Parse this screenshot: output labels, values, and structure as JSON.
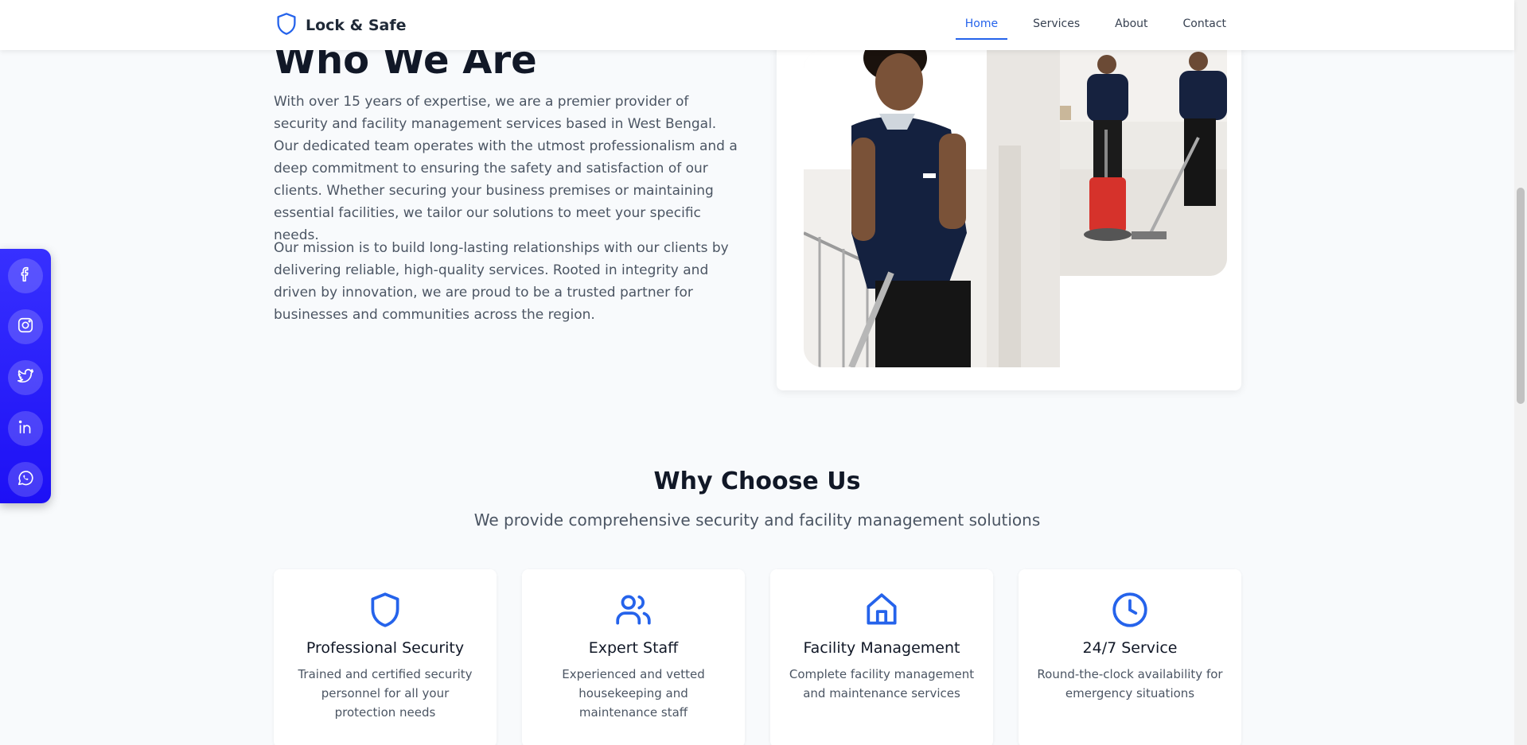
{
  "header": {
    "brand": "Lock & Safe",
    "nav": [
      "Home",
      "Services",
      "About",
      "Contact"
    ],
    "active_nav": "Home"
  },
  "about": {
    "title": "Who We Are",
    "paragraph1": "With over 15 years of expertise, we are a premier provider of security and facility management services based in West Bengal. Our dedicated team operates with the utmost professionalism and a deep commitment to ensuring the safety and satisfaction of our clients. Whether securing your business premises or maintaining essential facilities, we tailor our solutions to meet your specific needs.",
    "paragraph2": "Our mission is to build long-lasting relationships with our clients by delivering reliable, high-quality services. Rooted in integrity and driven by innovation, we are proud to be a trusted partner for businesses and communities across the region."
  },
  "social": [
    "facebook-icon",
    "instagram-icon",
    "twitter-icon",
    "linkedin-icon",
    "whatsapp-icon"
  ],
  "why": {
    "title": "Why Choose Us",
    "subtitle": "We provide comprehensive security and facility management solutions",
    "features": [
      {
        "icon": "shield-icon",
        "title": "Professional Security",
        "desc": "Trained and certified security personnel for all your protection needs"
      },
      {
        "icon": "users-icon",
        "title": "Expert Staff",
        "desc": "Experienced and vetted housekeeping and maintenance staff"
      },
      {
        "icon": "home-icon",
        "title": "Facility Management",
        "desc": "Complete facility management and maintenance services"
      },
      {
        "icon": "clock-icon",
        "title": "24/7 Service",
        "desc": "Round-the-clock availability for emergency situations"
      }
    ]
  },
  "colors": {
    "accent": "#2563eb",
    "social_bar": "#2a1cf7",
    "heading": "#111827",
    "body_text": "#4b5563"
  }
}
